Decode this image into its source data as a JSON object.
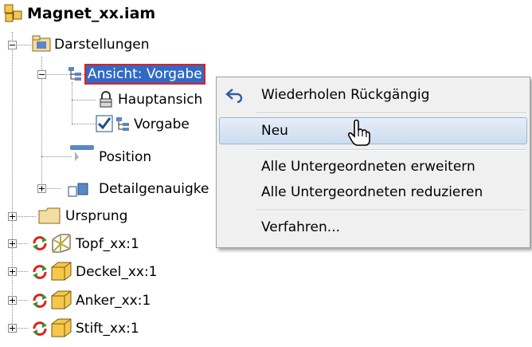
{
  "tree": {
    "root": "Magnet_xx.iam",
    "representations": "Darstellungen",
    "view": "Ansicht: Vorgabe",
    "main_view": "Hauptansich",
    "default_view": "Vorgabe",
    "position": "Position",
    "level_of_detail": "Detailgenauigke",
    "origin": "Ursprung",
    "parts": [
      "Topf_xx:1",
      "Deckel_xx:1",
      "Anker_xx:1",
      "Stift_xx:1"
    ]
  },
  "context_menu": {
    "repeat_undo": "Wiederholen Rückgängig",
    "new": "Neu",
    "expand_all": "Alle Untergeordneten erweitern",
    "collapse_all": "Alle Untergeordneten reduzieren",
    "procedures": "Verfahren..."
  },
  "colors": {
    "selection": "#316ac5",
    "selection_border": "#e02020",
    "part_box": "#f7c74b",
    "adaptive_arrows": "#e02020"
  }
}
